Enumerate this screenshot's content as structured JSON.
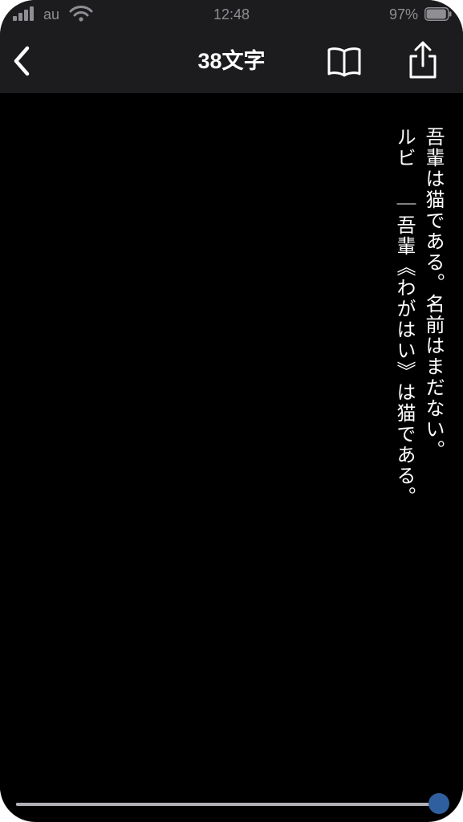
{
  "status_bar": {
    "carrier": "au",
    "time": "12:48",
    "battery_percent": "97%",
    "battery_level": 0.97
  },
  "nav": {
    "title": "38文字",
    "back_icon": "chevron-left-icon",
    "book_icon": "book-icon",
    "share_icon": "share-icon"
  },
  "content": {
    "line1": "吾輩は猫である。名前はまだない。",
    "ruby_label": "ルビ",
    "line2": "｜吾輩《わがはい》は猫である。"
  },
  "progress": {
    "value": 1.0
  },
  "colors": {
    "background": "#000000",
    "bar": "#1c1c1e",
    "text": "#ffffff",
    "accent": "#2f5f9e"
  }
}
